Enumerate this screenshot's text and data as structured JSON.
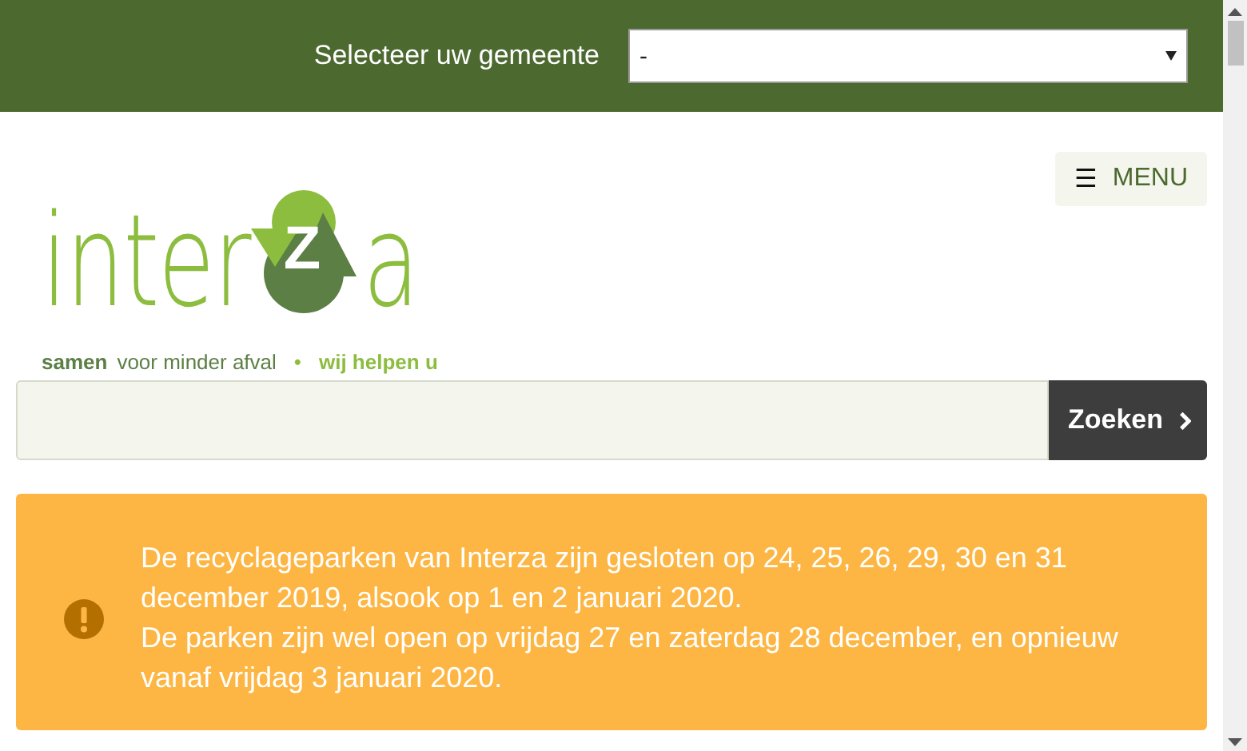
{
  "topbar": {
    "label": "Selecteer uw gemeente",
    "select": {
      "value": "-"
    }
  },
  "menu_button": {
    "icon": "☰",
    "label": "MENU"
  },
  "logo": {
    "before": "inter",
    "emblem": "Z",
    "after": "a",
    "tagline": [
      "samen",
      "voor minder afval",
      "•",
      "wij helpen u"
    ]
  },
  "search": {
    "button": "Zoeken"
  },
  "notice": {
    "paragraphs": [
      "De recyclageparken van Interza zijn gesloten op 24, 25, 26, 29, 30 en 31 december 2019, alsook op 1 en 2 januari 2020.",
      "De parken zijn wel open op vrijdag 27 en zaterdag 28 december, en opnieuw vanaf vrijdag 3 januari 2020."
    ]
  }
}
